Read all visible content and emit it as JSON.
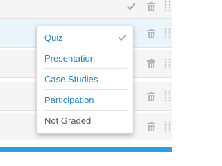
{
  "grading_menu": {
    "items": [
      {
        "label": "Quiz",
        "selected": true
      },
      {
        "label": "Presentation",
        "selected": false
      },
      {
        "label": "Case Studies",
        "selected": false
      },
      {
        "label": "Participation",
        "selected": false
      },
      {
        "label": "Not Graded",
        "selected": false
      }
    ]
  },
  "colors": {
    "link": "#2b7fc1",
    "row_highlight": "#eaf4fb",
    "accent_bar": "#2d9ee0"
  },
  "icons": [
    "check-icon",
    "trash-icon",
    "drag-handle-icon"
  ]
}
